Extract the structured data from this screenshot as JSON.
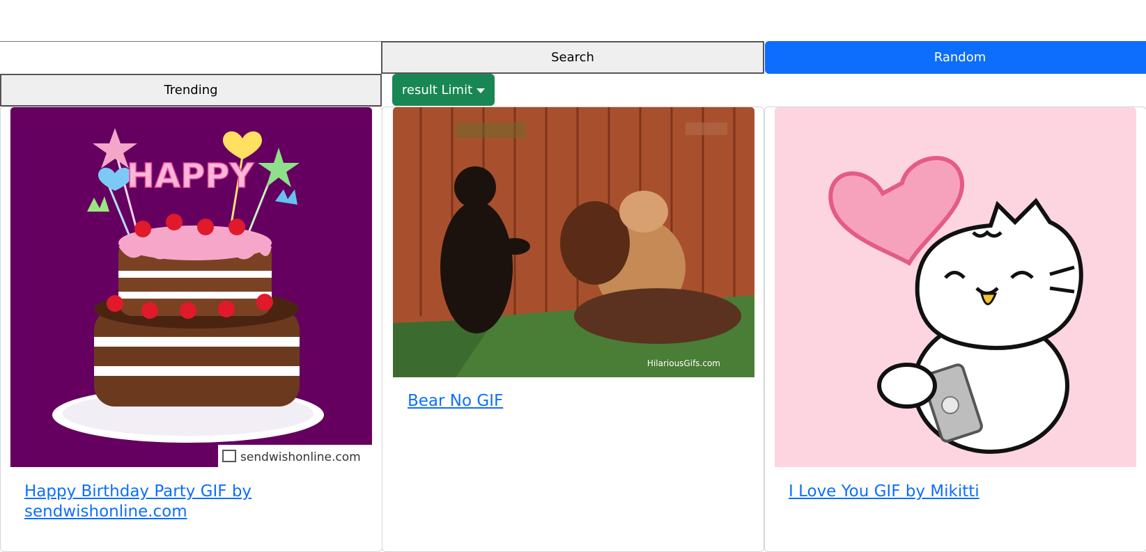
{
  "search": {
    "value": "",
    "placeholder": ""
  },
  "buttons": {
    "search": "Search",
    "random": "Random",
    "trending": "Trending",
    "result_limit": "result Limit"
  },
  "cards": [
    {
      "title": "Happy Birthday Party GIF by sendwishonline.com",
      "image_text_top": "HAPPY",
      "image_watermark": "sendwishonline.com",
      "background": "#650061"
    },
    {
      "title": "Bear No GIF",
      "image_watermark": "HilariousGifs.com",
      "background": "#a8502e"
    },
    {
      "title": "I Love You GIF by Mikitti",
      "background": "#fdd5e0"
    }
  ],
  "colors": {
    "primary": "#0d6efd",
    "success": "#198754",
    "link": "#0d6efd"
  }
}
